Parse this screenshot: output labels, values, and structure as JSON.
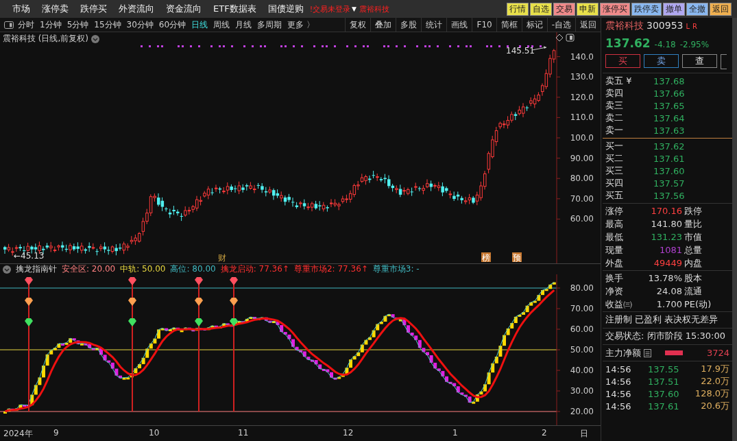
{
  "menu_bar": {
    "items": [
      "市场",
      "涨停卖",
      "跌停买",
      "外资流向",
      "资金流向",
      "ETF数据表",
      "国债逆购"
    ],
    "login_status": "!交易未登录",
    "dropdown": "▼",
    "stock_name": "震裕科技",
    "buttons": [
      {
        "label": "行情",
        "color": "#e8e04a"
      },
      {
        "label": "自选",
        "color": "#e8e04a"
      },
      {
        "label": "交易",
        "color": "#f08a8a"
      },
      {
        "label": "申新",
        "color": "#e8e04a"
      },
      {
        "label": "涨停买",
        "color": "#f08a8a"
      },
      {
        "label": "跌停卖",
        "color": "#8ab8f0"
      },
      {
        "label": "撤单",
        "color": "#b0a8f0"
      },
      {
        "label": "全撤",
        "color": "#8ab8f0"
      },
      {
        "label": "返回",
        "color": "#f0b050"
      }
    ]
  },
  "toolbar": {
    "periods": [
      {
        "label": "分时",
        "selected": false
      },
      {
        "label": "1分钟",
        "selected": false
      },
      {
        "label": "5分钟",
        "selected": false
      },
      {
        "label": "15分钟",
        "selected": false
      },
      {
        "label": "30分钟",
        "selected": false
      },
      {
        "label": "60分钟",
        "selected": false
      },
      {
        "label": "日线",
        "selected": true
      },
      {
        "label": "周线",
        "selected": false
      },
      {
        "label": "月线",
        "selected": false
      },
      {
        "label": "多周期",
        "selected": false
      }
    ],
    "more": "更多 〉",
    "tools": [
      "复权",
      "叠加",
      "多股",
      "统计",
      "画线",
      "F10",
      "简框",
      "标记",
      "-自选",
      "返回"
    ]
  },
  "price_chart": {
    "title": "震裕科技 (日线,前复权)",
    "yticks": [
      "140.0",
      "130.0",
      "120.0",
      "110.0",
      "100.0",
      "90.00",
      "80.00",
      "70.00",
      "60.00"
    ],
    "high_label": "145.51",
    "low_label": "←45.13",
    "event_marks": [
      {
        "text": "财",
        "kind": "plain"
      },
      {
        "text": "榜",
        "kind": "boxed"
      },
      {
        "text": "预",
        "kind": "boxed"
      }
    ]
  },
  "indicator": {
    "name": "擒龙指南针",
    "values": [
      {
        "text": "安全区: 20.00",
        "color": "#ff8080"
      },
      {
        "text": "中轨: 50.00",
        "color": "#e8d840"
      },
      {
        "text": "高位: 80.00",
        "color": "#40b8c0"
      },
      {
        "text": "擒龙启动: 77.36↑",
        "color": "#ff3030"
      },
      {
        "text": "尊重市场2: 77.36↑",
        "color": "#ff3030"
      },
      {
        "text": "尊重市场3: -",
        "color": "#40b8c0"
      }
    ],
    "yticks": [
      "80.00",
      "70.00",
      "60.00",
      "50.00",
      "40.00",
      "30.00",
      "20.00"
    ]
  },
  "x_axis": {
    "labels": [
      "2024年",
      "9",
      "10",
      "11",
      "12",
      "1",
      "2"
    ],
    "period": "日"
  },
  "quote_panel": {
    "name": "震裕科技",
    "code": "300953",
    "flags": [
      "L",
      "R"
    ],
    "price": "137.62",
    "change": "-4.18",
    "change_pct": "-2.95%",
    "actions": [
      {
        "label": "买",
        "kind": "buy"
      },
      {
        "label": "卖",
        "kind": "sell"
      },
      {
        "label": "查",
        "kind": "query"
      }
    ],
    "asks": [
      {
        "label": "卖五 ¥",
        "price": "137.68"
      },
      {
        "label": "卖四",
        "price": "137.66"
      },
      {
        "label": "卖三",
        "price": "137.65"
      },
      {
        "label": "卖二",
        "price": "137.64"
      },
      {
        "label": "卖一",
        "price": "137.63"
      }
    ],
    "bids": [
      {
        "label": "买一",
        "price": "137.62"
      },
      {
        "label": "买二",
        "price": "137.61"
      },
      {
        "label": "买三",
        "price": "137.60"
      },
      {
        "label": "买四",
        "price": "137.57"
      },
      {
        "label": "买五",
        "price": "137.56"
      }
    ],
    "stats": [
      {
        "label": "涨停",
        "value": "170.16",
        "color": "#ff4040",
        "label2": "跌停"
      },
      {
        "label": "最高",
        "value": "141.80",
        "color": "#d8d8d8",
        "label2": "量比"
      },
      {
        "label": "最低",
        "value": "131.23",
        "color": "#30b060",
        "label2": "市值"
      },
      {
        "label": "现量",
        "value": "1081",
        "color": "#b040d0",
        "label2": "总量"
      },
      {
        "label": "外盘",
        "value": "49449",
        "color": "#ff4040",
        "label2": "内盘"
      }
    ],
    "stats2": [
      {
        "label": "换手",
        "value": "13.78%",
        "color": "#d8d8d8",
        "label2": "股本"
      },
      {
        "label": "净资",
        "value": "24.08",
        "color": "#d8d8d8",
        "label2": "流通"
      },
      {
        "label": "收益㈢",
        "value": "1.700",
        "color": "#d8d8d8",
        "label2": "PE(动)"
      }
    ],
    "tags": "注册制 已盈利 表决权无差异",
    "trade_status": "交易状态: 闭市阶段 15:30:00",
    "main_flow": {
      "label": "主力净额",
      "value": "3724"
    },
    "trades": [
      {
        "time": "14:56",
        "price": "137.55",
        "volume": "17.9万"
      },
      {
        "time": "14:56",
        "price": "137.51",
        "volume": "22.0万"
      },
      {
        "time": "14:56",
        "price": "137.60",
        "volume": "128.0万"
      },
      {
        "time": "14:56",
        "price": "137.61",
        "volume": "20.6万"
      }
    ]
  }
}
